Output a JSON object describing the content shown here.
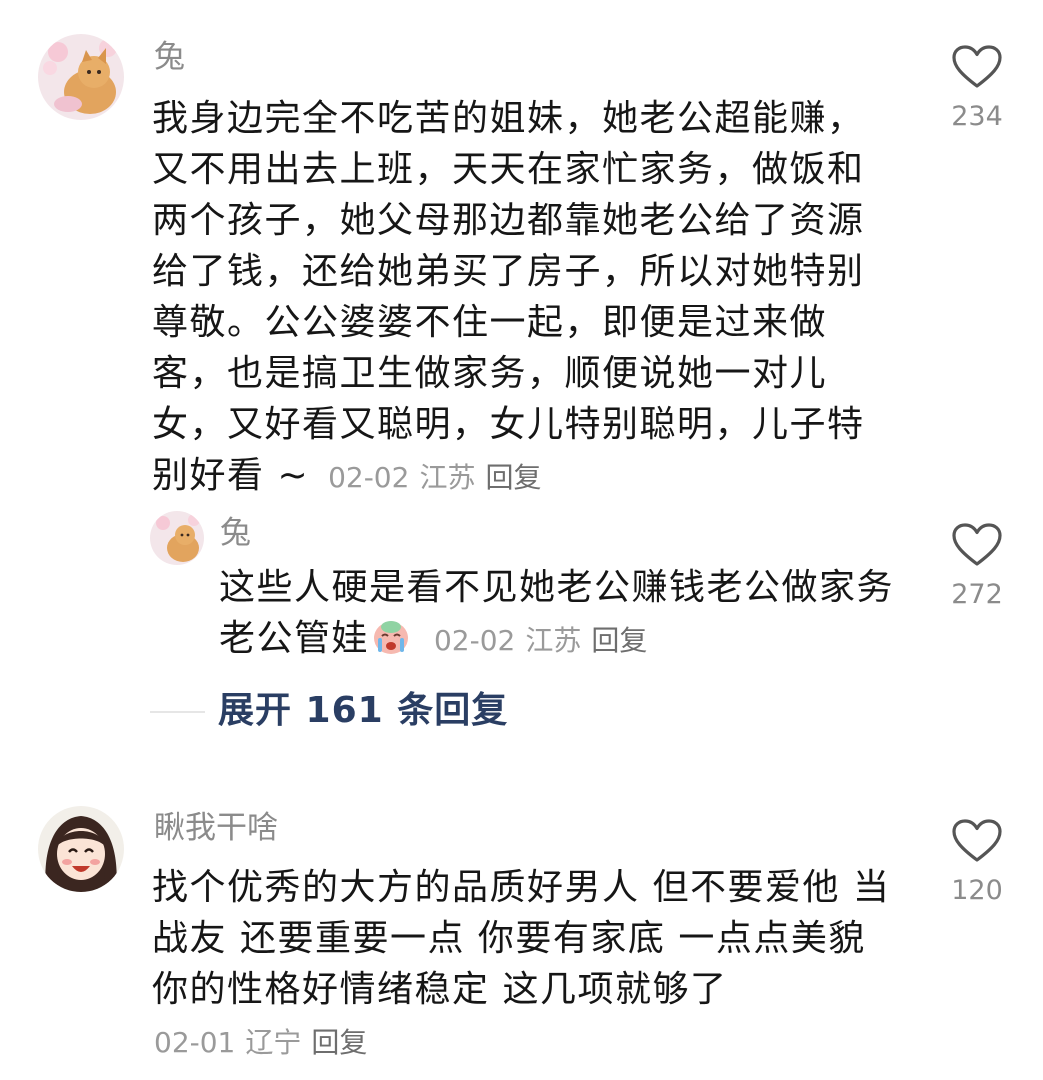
{
  "comments": [
    {
      "username": "兔",
      "lines": [
        "我身边完全不吃苦的姐妹，她老公超能赚，",
        "又不用出去上班，天天在家忙家务，做饭和",
        "两个孩子，她父母那边都靠她老公给了资源",
        "给了钱，还给她弟买了房子，所以对她特别",
        "尊敬。公公婆婆不住一起，即便是过来做",
        "客，也是搞卫生做家务，顺便说她一对儿",
        "女，又好看又聪明，女儿特别聪明，儿子特"
      ],
      "last_line": "别好看 ~",
      "date": "02-02",
      "location": "江苏",
      "reply_label": "回复",
      "likes": "234"
    },
    {
      "username": "兔",
      "line1": "这些人硬是看不见她老公赚钱老公做家务",
      "line2": "老公管娃",
      "date": "02-02",
      "location": "江苏",
      "reply_label": "回复",
      "likes": "272"
    },
    {
      "username": "瞅我干啥",
      "lines": [
        "找个优秀的大方的品质好男人 但不要爱他 当",
        "战友 还要重要一点 你要有家底 一点点美貌",
        "你的性格好情绪稳定 这几项就够了"
      ],
      "date": "02-01",
      "location": "辽宁",
      "reply_label": "回复",
      "likes": "120"
    }
  ],
  "expand_replies": "展开 161 条回复",
  "icons": {
    "like": "heart-outline-icon",
    "emoji": "crying-face-emoji-icon"
  },
  "colors": {
    "username": "#8b8b8b",
    "meta": "#9a9a9a",
    "expand": "#2a3e63"
  }
}
